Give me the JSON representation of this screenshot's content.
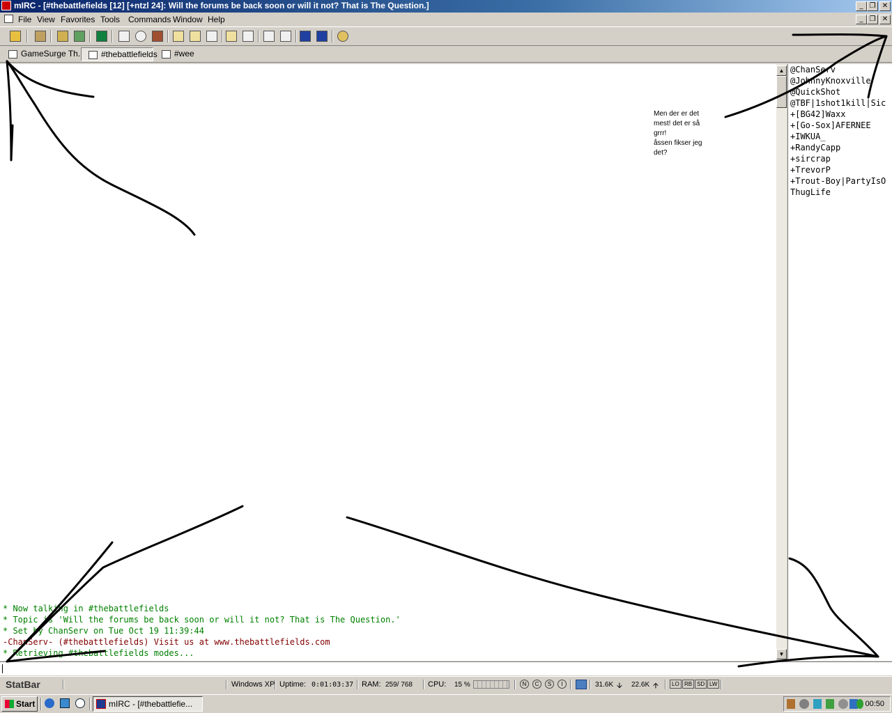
{
  "window": {
    "title": "mIRC - [#thebattlefields [12] [+ntzl 24]: Will the forums be back soon or will it not? That is The Question.]"
  },
  "menu": [
    "File",
    "View",
    "Favorites",
    "Tools",
    "Commands",
    "Window",
    "Help"
  ],
  "switchbar": {
    "tabs": [
      {
        "label": "GameSurge Th...",
        "active": false
      },
      {
        "label": "#thebattlefields",
        "active": true
      },
      {
        "label": "#wee",
        "active": false
      }
    ]
  },
  "annotation": {
    "note_lines": [
      "Men der er det",
      "mest! det er så",
      "grrr!",
      "åssen fikser jeg",
      "det?"
    ]
  },
  "nicklist": [
    "@ChanServ",
    "@JohnnyKnoxville",
    "@QuickShot",
    "@TBF|1shot1kill|Sic",
    "+[BG42]Waxx",
    "+[Go-Sox]AFERNEE",
    "+IWKUA_",
    "+RandyCapp",
    "+sircrap",
    "+TrevorP",
    "+Trout-Boy|PartyIsO",
    "ThugLife"
  ],
  "chat": {
    "lines": [
      {
        "text": "* Now talking in #thebattlefields",
        "color": "#008000"
      },
      {
        "text": "* Topic is 'Will the forums be back soon or will it not? That is The Question.'",
        "color": "#008000"
      },
      {
        "text": "* Set by ChanServ on Tue Oct 19 11:39:44",
        "color": "#008000"
      },
      {
        "text": "-ChanServ- (#thebattlefields) Visit us at www.thebattlefields.com",
        "color": "#800000"
      },
      {
        "text": "* Retrieving #thebattlefields modes...",
        "color": "#008000"
      }
    ]
  },
  "statbar": {
    "label": "StatBar",
    "os": "Windows XP",
    "uptime_label": "Uptime:",
    "uptime_value": "0:01:03:37",
    "ram_label": "RAM:",
    "ram_value": "259/ 768",
    "cpu_label": "CPU:",
    "cpu_value": "15 %",
    "circle_buttons": [
      "N",
      "C",
      "S",
      "I"
    ],
    "down_rate": "31.6K",
    "up_rate": "22.6K",
    "square_buttons": [
      "LO",
      "RB",
      "SD",
      "LW"
    ]
  },
  "taskbar": {
    "start_label": "Start",
    "task_label": "mIRC - [#thebattlefie...",
    "clock": "00:50"
  }
}
